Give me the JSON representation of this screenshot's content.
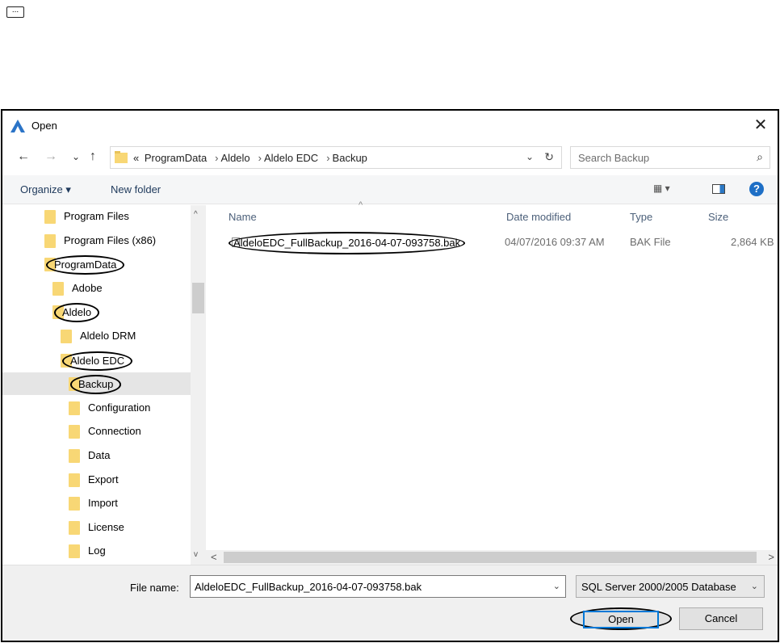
{
  "top_button": "...",
  "window": {
    "title": "Open",
    "close": "✕"
  },
  "navigation": {
    "back": "←",
    "forward": "→",
    "recent": "⌄",
    "up": "↑",
    "chevron": "«",
    "breadcrumbs": [
      "ProgramData",
      "Aldelo",
      "Aldelo EDC",
      "Backup"
    ],
    "breadcrumb_separator": "›",
    "dropdown": "⌄",
    "refresh": "↻"
  },
  "search": {
    "placeholder": "Search Backup",
    "icon": "⌕"
  },
  "toolbar": {
    "organize": "Organize ▾",
    "new_folder": "New folder",
    "views": "▦ ▾",
    "help": "?"
  },
  "tree": [
    {
      "label": "Program Files",
      "indent": 0
    },
    {
      "label": "Program Files (x86)",
      "indent": 0
    },
    {
      "label": "ProgramData",
      "indent": 0,
      "circled": true
    },
    {
      "label": "Adobe",
      "indent": 1
    },
    {
      "label": "Aldelo",
      "indent": 1,
      "circled": true
    },
    {
      "label": "Aldelo DRM",
      "indent": 2
    },
    {
      "label": "Aldelo EDC",
      "indent": 2,
      "circled": true
    },
    {
      "label": "Backup",
      "indent": 3,
      "circled": true,
      "selected": true
    },
    {
      "label": "Configuration",
      "indent": 3
    },
    {
      "label": "Connection",
      "indent": 3
    },
    {
      "label": "Data",
      "indent": 3
    },
    {
      "label": "Export",
      "indent": 3
    },
    {
      "label": "Import",
      "indent": 3
    },
    {
      "label": "License",
      "indent": 3
    },
    {
      "label": "Log",
      "indent": 3
    }
  ],
  "file_list": {
    "columns": [
      "Name",
      "Date modified",
      "Type",
      "Size"
    ],
    "sort_caret": "^",
    "rows": [
      {
        "name": "AldeloEDC_FullBackup_2016-04-07-093758.bak",
        "date_modified": "04/07/2016 09:37 AM",
        "type": "BAK File",
        "size": "2,864 KB"
      }
    ]
  },
  "scrollbars": {
    "up": "^",
    "down": "v",
    "left": "<",
    "right": ">"
  },
  "footer": {
    "file_name_label": "File name:",
    "file_name_value": "AldeloEDC_FullBackup_2016-04-07-093758.bak",
    "file_type_value": "SQL Server 2000/2005 Database",
    "dropdown": "⌄",
    "open_button": "Open",
    "cancel_button": "Cancel"
  }
}
